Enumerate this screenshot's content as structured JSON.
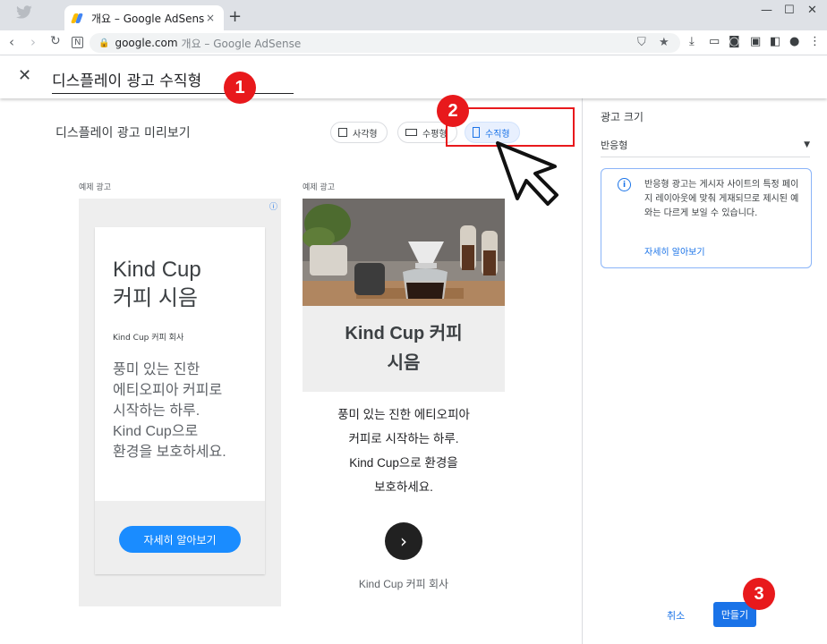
{
  "browser": {
    "tab_title": "개요 – Google AdSense",
    "tab_close": "×",
    "new_tab": "+",
    "url_host": "google.com",
    "url_rest": "개요 – Google AdSense"
  },
  "header": {
    "close": "✕",
    "ad_name": "디스플레이 광고 수직형"
  },
  "badges": {
    "one": "1",
    "two": "2",
    "three": "3"
  },
  "preview": {
    "title": "디스플레이 광고 미리보기",
    "chips": [
      {
        "label": "사각형",
        "active": false
      },
      {
        "label": "수평형",
        "active": false
      },
      {
        "label": "수직형",
        "active": true
      }
    ],
    "sample_label": "예제 광고"
  },
  "ad1": {
    "headline_1": "Kind Cup",
    "headline_2": "커피 시음",
    "advertiser": "Kind Cup 커피 회사",
    "desc_1": "풍미 있는 진한",
    "desc_2": "에티오피아 커피로",
    "desc_3": "시작하는 하루.",
    "desc_4": "Kind Cup으로",
    "desc_5": "환경을 보호하세요.",
    "cta": "자세히 알아보기",
    "info_icon": "ⓘ"
  },
  "ad2": {
    "headline_1": "Kind Cup 커피",
    "headline_2": "시음",
    "desc_1": "풍미 있는 진한 에티오피아",
    "desc_2": "커피로 시작하는 하루.",
    "desc_3": "Kind Cup으로 환경을",
    "desc_4": "보호하세요.",
    "arrow": "›",
    "advertiser": "Kind Cup 커피 회사"
  },
  "side": {
    "heading": "광고 크기",
    "select_value": "반응형",
    "info_text": "반응형 광고는 게시자 사이트의 특정 페이지 레이아웃에 맞춰 게재되므로 제시된 예와는 다르게 보일 수 있습니다.",
    "info_link": "자세히 알아보기",
    "cancel": "취소",
    "create": "만들기"
  },
  "colors": {
    "accent": "#1a73e8",
    "annotation_red": "#e8191c",
    "cta_blue": "#1a8cff"
  }
}
